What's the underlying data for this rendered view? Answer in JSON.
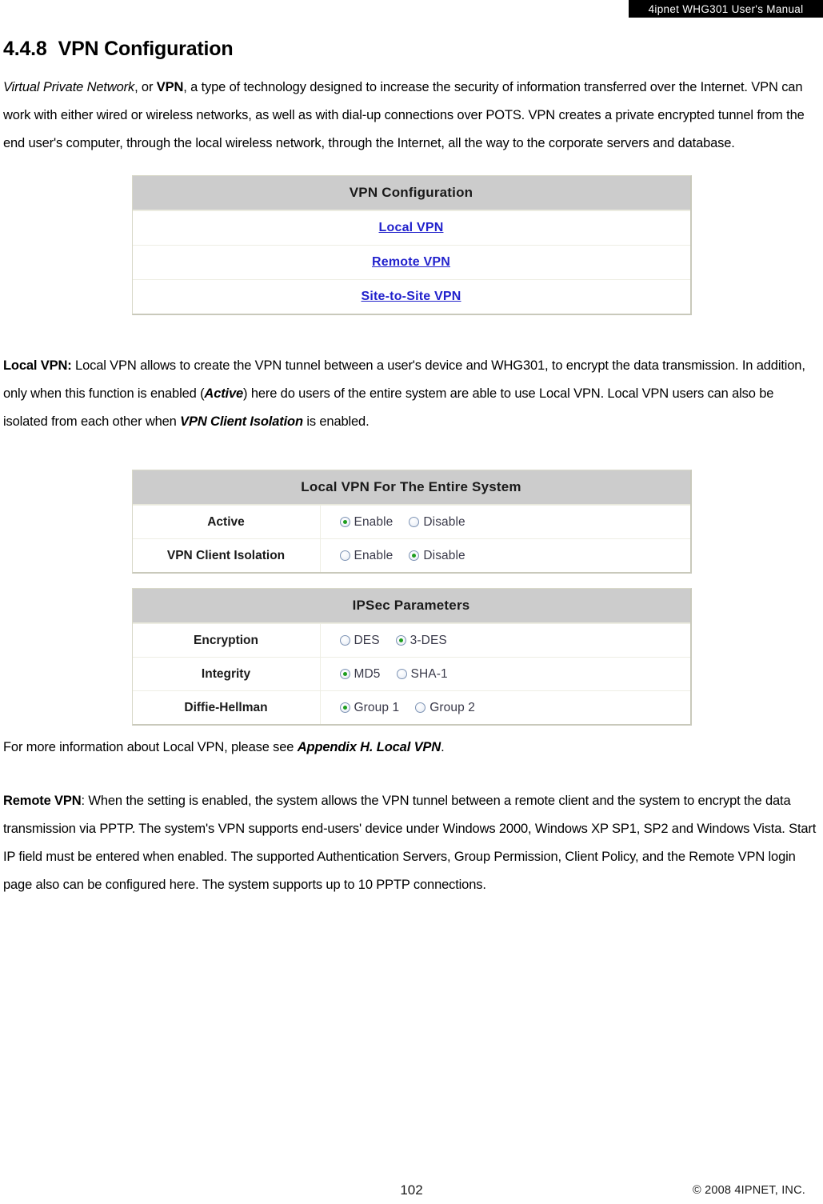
{
  "header": {
    "manual_title": "4ipnet WHG301 User's Manual"
  },
  "section": {
    "number": "4.4.8",
    "title": "VPN Configuration"
  },
  "intro_paragraph": {
    "part1_italic": "Virtual Private Network",
    "part2": ", or ",
    "part3_bold": "VPN",
    "part4": ", a type of technology designed to increase the security of information transferred over the Internet. VPN can work with either wired or wireless networks, as well as with dial-up connections over POTS. VPN creates a private encrypted tunnel from the end user's computer, through the local wireless network, through the Internet, all the way to the corporate servers and database."
  },
  "vpn_config_table": {
    "header": "VPN Configuration",
    "links": [
      {
        "label": "Local VPN"
      },
      {
        "label": "Remote VPN"
      },
      {
        "label": "Site-to-Site VPN"
      }
    ]
  },
  "local_vpn_paragraph": {
    "lead_bold": "Local VPN:",
    "text1": " Local VPN allows to create the VPN tunnel between a user's device and WHG301, to encrypt the data transmission. In addition, only when this function is enabled (",
    "emphasis1": "Active",
    "text2": ") here do users of the entire system are able to use Local VPN. Local VPN users can also be isolated from each other when ",
    "emphasis2": "VPN Client Isolation",
    "text3": " is enabled."
  },
  "local_vpn_table": {
    "header": "Local VPN For The Entire System",
    "rows": [
      {
        "label": "Active",
        "options": [
          {
            "label": "Enable",
            "selected": true
          },
          {
            "label": "Disable",
            "selected": false
          }
        ]
      },
      {
        "label": "VPN Client Isolation",
        "options": [
          {
            "label": "Enable",
            "selected": false
          },
          {
            "label": "Disable",
            "selected": true
          }
        ]
      }
    ]
  },
  "ipsec_table": {
    "header": "IPSec Parameters",
    "rows": [
      {
        "label": "Encryption",
        "options": [
          {
            "label": "DES",
            "selected": false
          },
          {
            "label": "3-DES",
            "selected": true
          }
        ]
      },
      {
        "label": "Integrity",
        "options": [
          {
            "label": "MD5",
            "selected": true
          },
          {
            "label": "SHA-1",
            "selected": false
          }
        ]
      },
      {
        "label": "Diffie-Hellman",
        "options": [
          {
            "label": "Group 1",
            "selected": true
          },
          {
            "label": "Group 2",
            "selected": false
          }
        ]
      }
    ]
  },
  "appendix_paragraph": {
    "text1": "For more information about Local VPN, please see ",
    "emphasis": "Appendix H. Local VPN",
    "text2": "."
  },
  "remote_vpn_paragraph": {
    "lead_bold": "Remote VPN",
    "text": ": When the setting is enabled, the system allows the VPN tunnel between a remote client and the system to encrypt the data transmission via PPTP. The system's VPN supports end-users' device under Windows 2000, Windows XP SP1, SP2 and Windows Vista. Start IP field must be entered when enabled. The supported Authentication Servers, Group Permission, Client Policy, and the Remote VPN login page also can be configured here. The system supports up to 10 PPTP connections."
  },
  "footer": {
    "page_number": "102",
    "copyright": "© 2008 4IPNET, INC."
  }
}
